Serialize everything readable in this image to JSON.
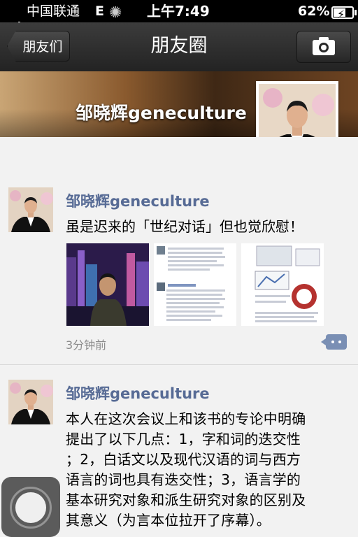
{
  "status_bar": {
    "carrier": "中国联通",
    "network": "E",
    "time": "上午7:49",
    "battery_percent": "62%",
    "battery_level": 0.62
  },
  "nav": {
    "back_label": "朋友们",
    "title": "朋友圈",
    "camera_icon": "camera-icon"
  },
  "cover": {
    "name": "邹晓辉geneculture"
  },
  "posts": [
    {
      "author": "邹晓辉geneculture",
      "text": "虽是迟来的「世纪对话」但也觉欣慰！",
      "time": "3分钟前"
    },
    {
      "author": "邹晓辉geneculture",
      "text_lines": [
        "本人在这次会议上和该书的专论中明确",
        "提出了以下几点：1，字和词的迭交性",
        "；2，白话文以及现代汉语的词与西方",
        "语言的词也具有迭交性；3，语言学的",
        "基本研究对象和派生研究对象的区别及",
        "其意义（为言本位拉开了序幕）。"
      ]
    }
  ],
  "colors": {
    "author_link": "#576b95",
    "nav_bg": "#2e2e2e",
    "feed_bg": "#f2f2f2"
  }
}
